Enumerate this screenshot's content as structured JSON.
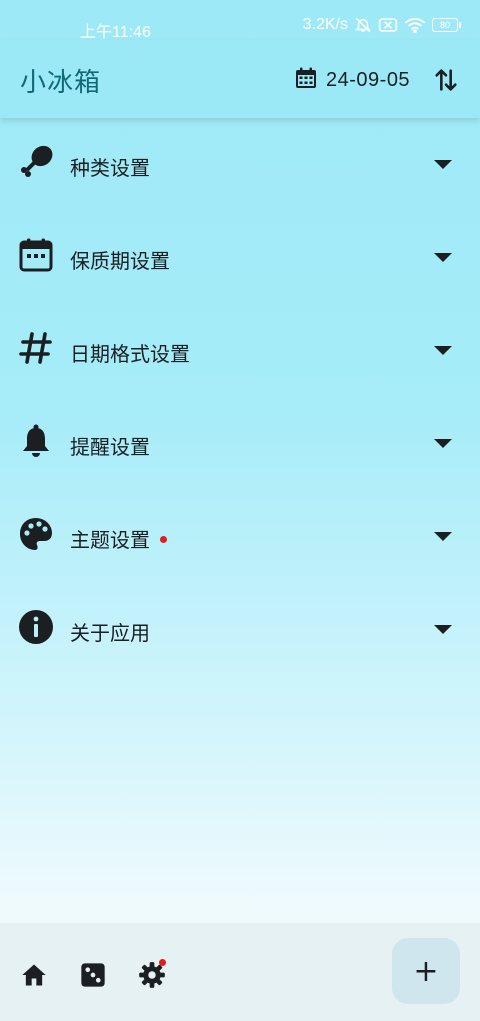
{
  "status_bar": {
    "time": "上午11:46",
    "net_speed": "3.2K/s",
    "battery": "80",
    "icons": [
      "mute-bell-icon",
      "no-sim-icon",
      "wifi-icon",
      "battery-icon"
    ]
  },
  "app_bar": {
    "title": "小冰箱",
    "date": "24-09-05",
    "icons": [
      "calendar-icon",
      "sort-icon"
    ]
  },
  "settings": [
    {
      "label": "种类设置",
      "icon": "drumstick-icon",
      "badge": false
    },
    {
      "label": "保质期设置",
      "icon": "calendar-icon",
      "badge": false
    },
    {
      "label": "日期格式设置",
      "icon": "hash-icon",
      "badge": false
    },
    {
      "label": "提醒设置",
      "icon": "bell-icon",
      "badge": false
    },
    {
      "label": "主题设置",
      "icon": "palette-icon",
      "badge": true
    },
    {
      "label": "关于应用",
      "icon": "info-icon",
      "badge": false
    }
  ],
  "bottom_nav": {
    "items": [
      "home-icon",
      "dice-icon",
      "gear-icon"
    ],
    "active": "gear-icon",
    "fab_label": "+"
  },
  "colors": {
    "accent": "#116977",
    "badge": "#e21d1d",
    "app_bar": "#9be8f7",
    "bottom_bar": "#e6f1f4"
  }
}
